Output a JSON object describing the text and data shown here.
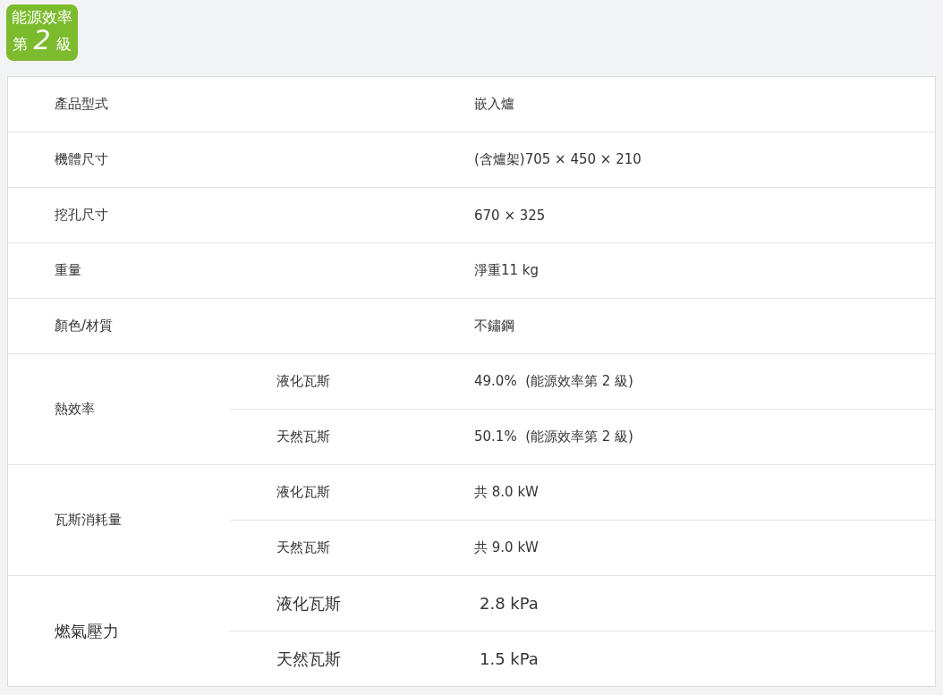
{
  "badge": {
    "title": "能源效率",
    "prefix": "第",
    "grade": "2",
    "suffix": "級"
  },
  "specs": [
    {
      "label": "產品型式",
      "value": "嵌入爐",
      "large_text": false
    },
    {
      "label": "機體尺寸",
      "value": "(含爐架)705 × 450 × 210",
      "large_text": false
    },
    {
      "label": "挖孔尺寸",
      "value": "670 × 325",
      "large_text": false
    },
    {
      "label": "重量",
      "value": "淨重11 kg",
      "large_text": false
    },
    {
      "label": "顏色/材質",
      "value": "不鏽鋼",
      "large_text": false
    },
    {
      "label": "熱效率",
      "large_text": false,
      "subrows": [
        {
          "label": "液化瓦斯",
          "value": "49.0%  (能源效率第 2 級)"
        },
        {
          "label": "天然瓦斯",
          "value": "50.1%  (能源效率第 2 級)"
        }
      ]
    },
    {
      "label": "瓦斯消耗量",
      "large_text": false,
      "subrows": [
        {
          "label": "液化瓦斯",
          "value": "共 8.0 kW"
        },
        {
          "label": "天然瓦斯",
          "value": "共 9.0 kW"
        }
      ]
    },
    {
      "label": "燃氣壓力",
      "large_text": true,
      "subrows": [
        {
          "label": "液化瓦斯",
          "value": "2.8 kPa"
        },
        {
          "label": "天然瓦斯",
          "value": "1.5 kPa"
        }
      ]
    }
  ]
}
